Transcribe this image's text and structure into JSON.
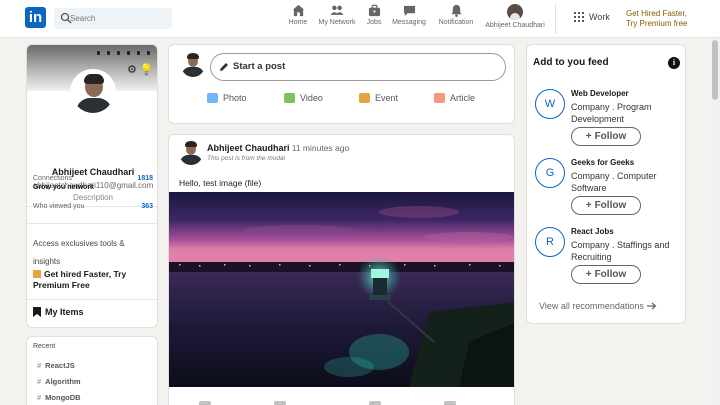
{
  "nav": {
    "logo_text": "in",
    "search_placeholder": "Search",
    "items": [
      {
        "label": "Home",
        "icon": "home-icon"
      },
      {
        "label": "My Network",
        "icon": "network-icon"
      },
      {
        "label": "Jobs",
        "icon": "briefcase-icon"
      },
      {
        "label": "Messaging",
        "icon": "messaging-icon"
      },
      {
        "label": "Notification",
        "icon": "bell-icon"
      }
    ],
    "me_label": "Abhijeet Chaudhari",
    "work_label": "Work",
    "premium_line1": "Get Hired Faster,",
    "premium_line2": "Try Premium free"
  },
  "profile": {
    "name": "Abhijeet Chaudhari",
    "email": "abhijeetchaudhari110@gmail.com",
    "description": "Description",
    "connections_label": "Connections",
    "connections_sub": "Grow you network",
    "connections_value": "1818",
    "viewed_label": "Who viewed you",
    "viewed_value": "363",
    "access_text": "Access exclusives tools & insights",
    "premium_text": "Get hired Faster, Try Premium Free",
    "my_items": "My Items"
  },
  "recent": {
    "title": "Recent",
    "tags": [
      "ReactJS",
      "Algorithm",
      "MongoDB"
    ]
  },
  "start_post": {
    "placeholder": "Start a post",
    "actions": [
      {
        "label": "Photo",
        "color": "#70b5f9"
      },
      {
        "label": "Video",
        "color": "#7fc15e"
      },
      {
        "label": "Event",
        "color": "#e7a33e"
      },
      {
        "label": "Article",
        "color": "#f5987e"
      }
    ]
  },
  "post": {
    "author": "Abhijeet Chaudhari",
    "time": ". 11 minutes ago",
    "subtitle": "This post is from the modal",
    "text": "Hello, test image (file)"
  },
  "feed": {
    "title": "Add to you feed",
    "recommendations": [
      {
        "initial": "W",
        "name": "Web Developer",
        "desc": "Company . Program Development",
        "follow": "Follow"
      },
      {
        "initial": "G",
        "name": "Geeks for Geeks",
        "desc": "Company . Computer Software",
        "follow": "Follow"
      },
      {
        "initial": "R",
        "name": "React Jobs",
        "desc": "Company . Staffings and Recruiting",
        "follow": "Follow"
      }
    ],
    "view_all": "View all recommendations"
  },
  "colors": {
    "brand": "#0a66c2",
    "background": "#f3f2ef",
    "premium": "#8a5a00"
  }
}
